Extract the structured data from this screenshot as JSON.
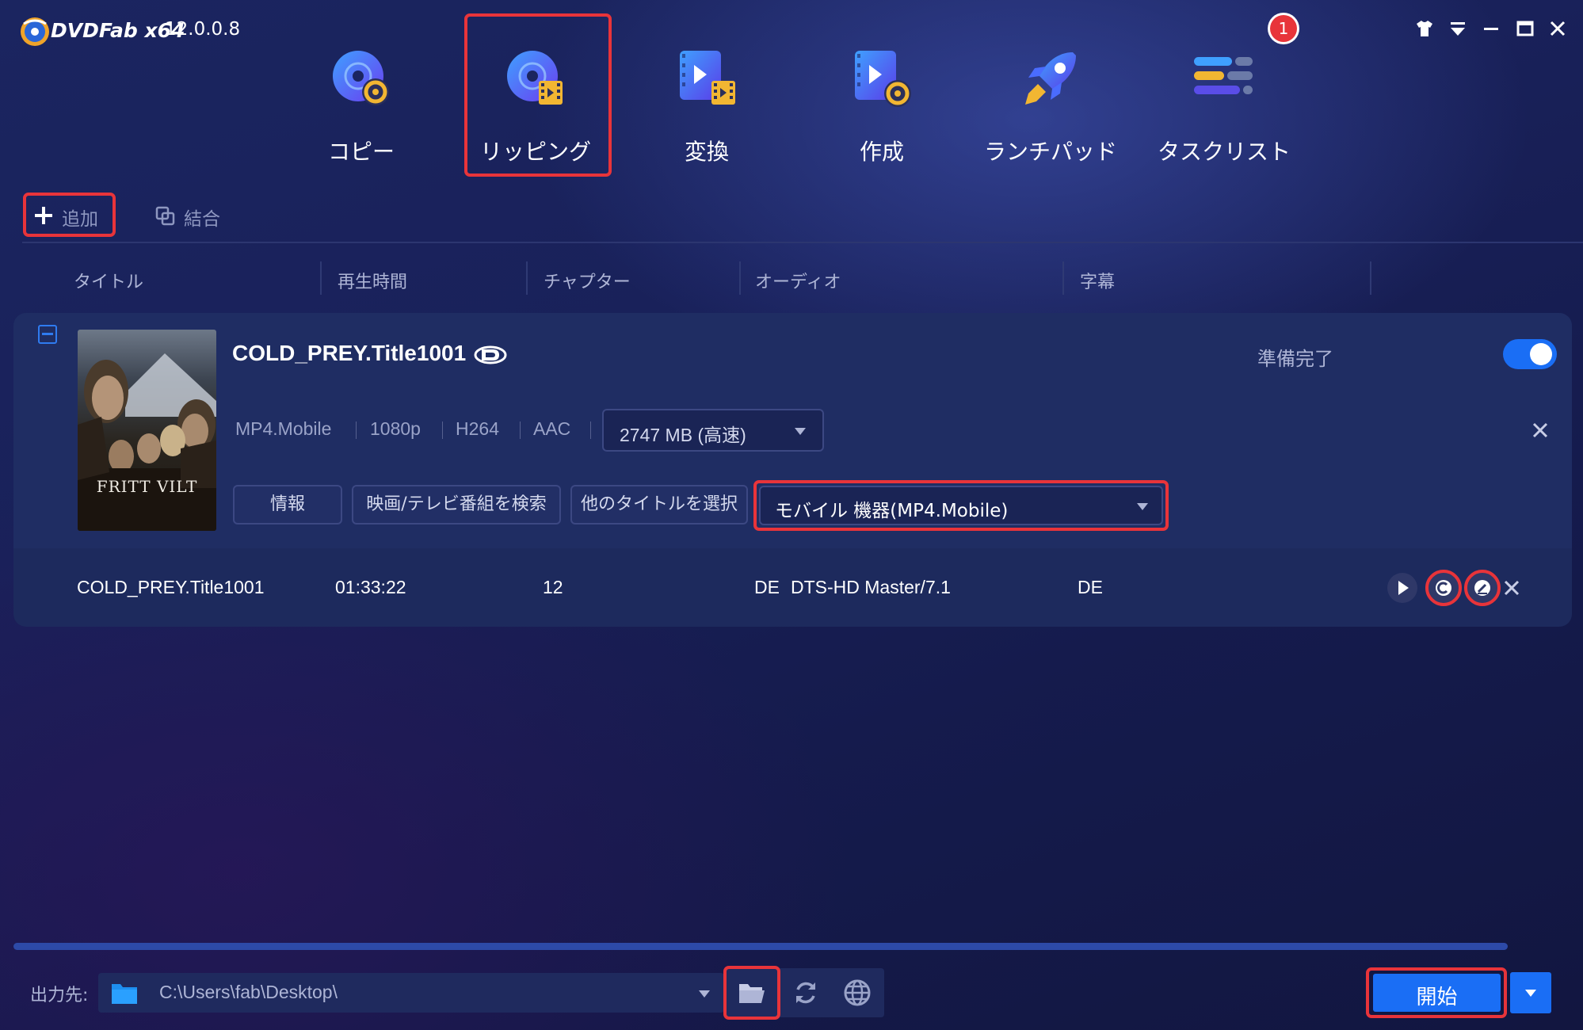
{
  "app": {
    "name": "DVDFab x64",
    "version": "12.0.0.8",
    "notification_count": "1",
    "window_controls": [
      "skin-shirt-icon",
      "menu-dropdown-icon",
      "minimize-icon",
      "maximize-icon",
      "close-icon"
    ]
  },
  "nav": [
    {
      "label": "コピー",
      "icon": "copy-disc-icon"
    },
    {
      "label": "リッピング",
      "icon": "ripper-disc-film-icon",
      "selected": true
    },
    {
      "label": "変換",
      "icon": "converter-video-icon"
    },
    {
      "label": "作成",
      "icon": "creator-video-disc-icon"
    },
    {
      "label": "ランチパッド",
      "icon": "launchpad-rocket-icon"
    },
    {
      "label": "タスクリスト",
      "icon": "task-list-icon"
    }
  ],
  "toolbar": {
    "add_label": "追加",
    "merge_label": "結合"
  },
  "columns": [
    "タイトル",
    "再生時間",
    "チャプター",
    "オーディオ",
    "字幕"
  ],
  "task": {
    "title": "COLD_PREY.Title1001",
    "status": "準備完了",
    "enabled": true,
    "poster_text": "FRITT VILT",
    "specs": [
      "MP4.Mobile",
      "1080p",
      "H264",
      "AAC"
    ],
    "size_option": "2747 MB (高速)",
    "buttons": {
      "info": "情報",
      "search": "映画/テレビ番組を検索",
      "other_title": "他のタイトルを選択"
    },
    "profile": "モバイル 機器(MP4.Mobile)",
    "row": {
      "title": "COLD_PREY.Title1001",
      "duration": "01:33:22",
      "chapters": "12",
      "audio_lang": "DE",
      "audio_format": "DTS-HD Master/7.1",
      "subtitle": "DE"
    }
  },
  "output": {
    "label": "出力先:",
    "path": "C:\\Users\\fab\\Desktop\\"
  },
  "start_label": "開始",
  "colors": {
    "accent": "#1a6ef5",
    "highlight_outline": "#e8343a",
    "background": "#19215a",
    "card": "#1f2d63"
  }
}
